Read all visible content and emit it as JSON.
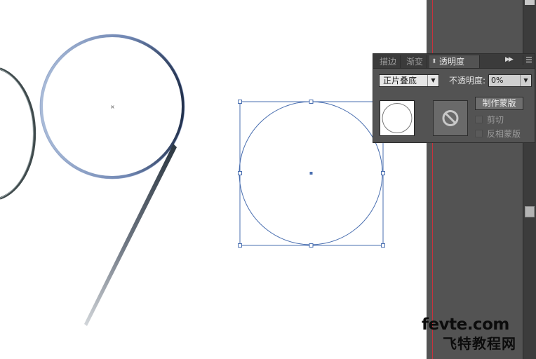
{
  "panel": {
    "tabs": [
      {
        "label": "描边",
        "active": false
      },
      {
        "label": "渐变",
        "active": false
      },
      {
        "label": "透明度",
        "active": true
      }
    ],
    "expand_icon": "double-chevron-right-icon",
    "menu_icon": "panel-menu-icon",
    "blend_mode": "正片叠底",
    "opacity_label": "不透明度:",
    "opacity_value": "0%",
    "make_mask_label": "制作蒙版",
    "clip_label": "剪切",
    "invert_mask_label": "反相蒙版",
    "clip_checked": false,
    "invert_checked": false
  },
  "watermark": {
    "line1": "fevte.com",
    "line2": "飞特教程网"
  },
  "colors": {
    "canvas_dark": "#535353",
    "guide": "#c8323c",
    "selection": "#4a6fb0"
  }
}
